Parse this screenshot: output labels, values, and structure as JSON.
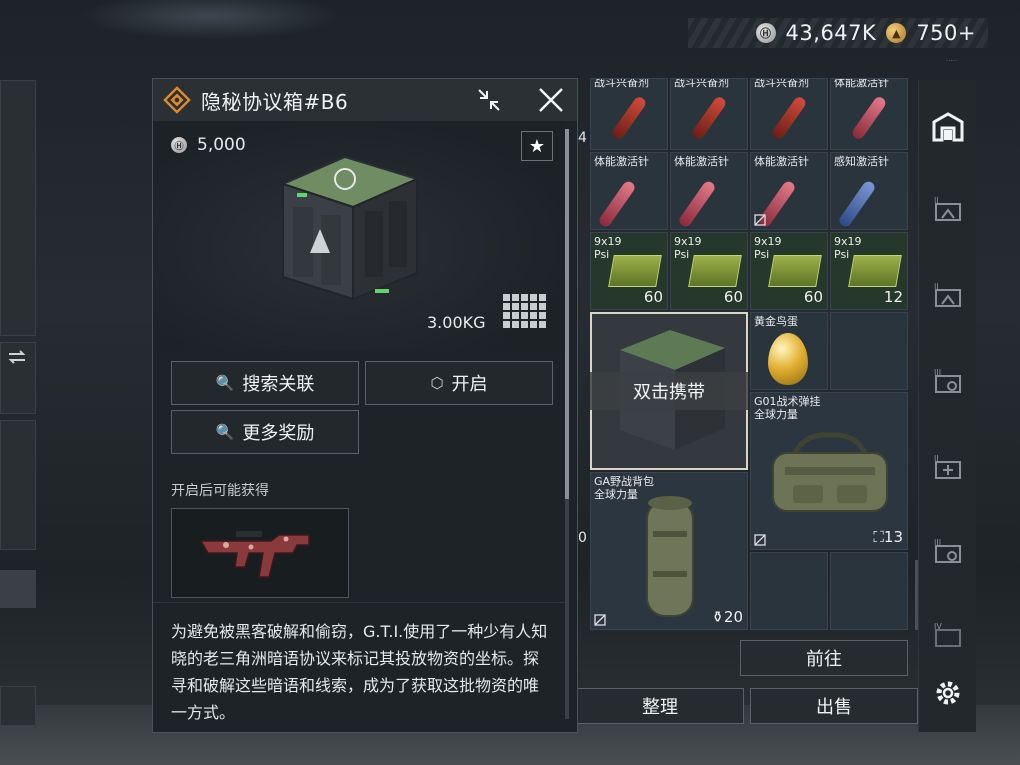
{
  "currency": {
    "silver_value": "43,647K",
    "gold_value": "750+"
  },
  "popup": {
    "title": "隐秘协议箱#B6",
    "price": "5,000",
    "weight": "3.00KG",
    "buttons": {
      "search_related": "搜索关联",
      "open": "开启",
      "more_rewards": "更多奖励"
    },
    "possible_label": "开启后可能获得",
    "description": "为避免被黑客破解和偷窃，G.T.I.使用了一种少有人知晓的老三角洲暗语协议来标记其投放物资的坐标。探寻和破解这些暗语和线索，成为了获取这批物资的唯一方式。"
  },
  "inventory": {
    "row0": [
      "战斗兴奋剂",
      "战斗兴奋剂",
      "战斗兴奋剂",
      "体能激活针"
    ],
    "row1": [
      "体能激活针",
      "体能激活针",
      "体能激活针",
      "感知激活针"
    ],
    "ammo_cells": [
      {
        "label1": "9x19",
        "label2": "Psi",
        "count": "60"
      },
      {
        "label1": "9x19",
        "label2": "Psi",
        "count": "60"
      },
      {
        "label1": "9x19",
        "label2": "Psi",
        "count": "60"
      },
      {
        "label1": "9x19",
        "label2": "Psi",
        "count": "12"
      }
    ],
    "selected_overlay": "双击携带",
    "golden_egg": "黄金鸟蛋",
    "duffel": {
      "name": "G01战术弹挂",
      "sub": "全球力量",
      "count": "13"
    },
    "backpack": {
      "name": "GA野战背包",
      "sub": "全球力量",
      "count": "20"
    },
    "left_count": "4",
    "left_count2": "0"
  },
  "actions": {
    "goto": "前往",
    "organize": "整理",
    "sell": "出售"
  },
  "sidebar": {
    "icons": [
      "safe-house-icon",
      "level-2-container-icon",
      "level-2-container-icon",
      "level-3-container-icon",
      "level-2-medical-container-icon",
      "level-3-container-icon",
      "level-4-container-icon",
      "settings-icon"
    ],
    "labels": [
      "II",
      "II",
      "III",
      "II",
      "III",
      "IV"
    ]
  },
  "colors": {
    "accent_orange": "#e08a2e",
    "panel_bg": "#1e2328",
    "cell_bg": "#2a343d",
    "ammo_green": "#26382b"
  }
}
